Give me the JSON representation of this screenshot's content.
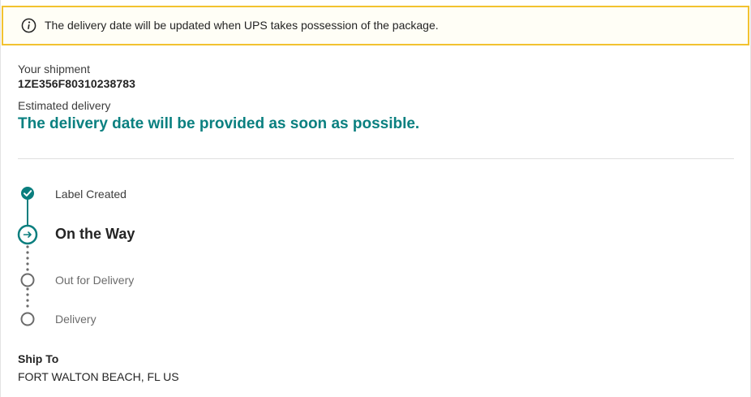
{
  "alert": {
    "icon": "info-icon",
    "text": "The delivery date will be updated when UPS takes possession of the package.",
    "border_color": "#f2c230"
  },
  "shipment": {
    "label": "Your shipment",
    "tracking_number": "1ZE356F80310238783"
  },
  "estimate": {
    "label": "Estimated delivery",
    "message": "The delivery date will be provided as soon as possible.",
    "color": "#0a8080"
  },
  "progress": {
    "steps": [
      {
        "label": "Label Created",
        "state": "complete",
        "icon": "check-icon"
      },
      {
        "label": "On the Way",
        "state": "current",
        "icon": "arrow-right-icon"
      },
      {
        "label": "Out for Delivery",
        "state": "pending",
        "icon": "empty-circle-icon"
      },
      {
        "label": "Delivery",
        "state": "pending",
        "icon": "empty-circle-icon"
      }
    ],
    "accent_color": "#0a7e7e",
    "pending_color": "#6b6b6b"
  },
  "ship_to": {
    "title": "Ship To",
    "address": "FORT WALTON BEACH, FL US"
  }
}
